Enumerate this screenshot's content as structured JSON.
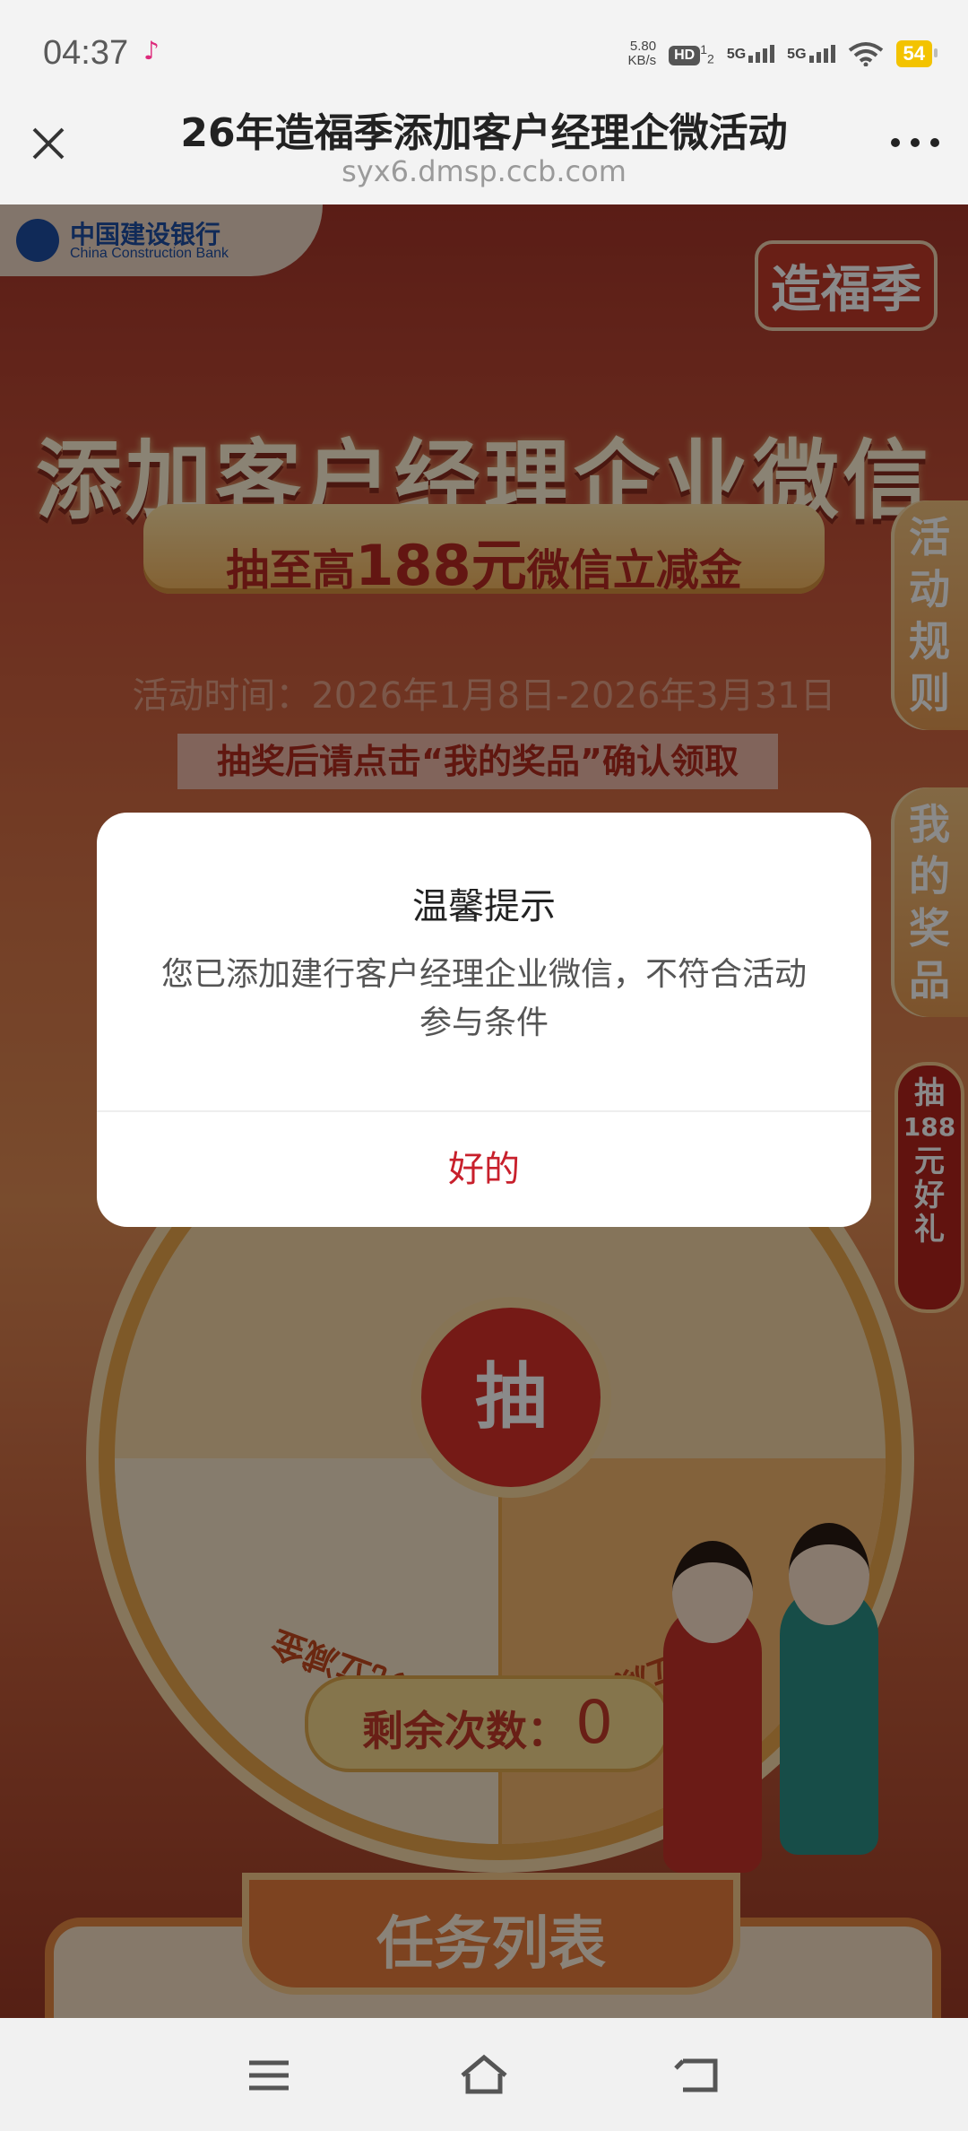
{
  "status_bar": {
    "time": "04:37",
    "net_speed_value": "5.80",
    "net_speed_unit": "KB/s",
    "hd_label": "HD",
    "sim1": "1",
    "sim2": "2",
    "signal1_label": "5G",
    "signal2_label": "5G",
    "battery": "54",
    "battery_color": "#f3c300"
  },
  "browser": {
    "title": "26年造福季添加客户经理企微活动",
    "url": "syx6.dmsp.ccb.com"
  },
  "page": {
    "bank_name_cn": "中国建设银行",
    "bank_name_en": "China Construction Bank",
    "season_badge": "造福季",
    "hero_title": "添加客户经理企业微信",
    "ribbon_prefix": "抽至高",
    "ribbon_amount": "188元",
    "ribbon_suffix": "微信立减金",
    "activity_time": "活动时间：2026年1月8日-2026年3月31日",
    "notice": "抽奖后请点击“我的奖品”确认领取",
    "side_tab_rules": [
      "活",
      "动",
      "规",
      "则"
    ],
    "side_tab_prizes": [
      "我",
      "的",
      "奖",
      "品"
    ],
    "side_prize_badge": [
      "抽",
      "188",
      "元",
      "好",
      "礼"
    ],
    "wheel_center": "抽",
    "prize_left": "5元立减金",
    "prize_right": "26元立减金",
    "remaining_label": "剩余次数：",
    "remaining_count": "0",
    "task_list_title": "任务列表"
  },
  "dialog": {
    "title": "温馨提示",
    "message": "您已添加建行客户经理企业微信，不符合活动参与条件",
    "ok_button": "好的",
    "ok_color": "#c8202c"
  },
  "nav_bar": {
    "menu_icon": "menu-icon",
    "home_icon": "home-icon",
    "back_icon": "back-icon"
  }
}
